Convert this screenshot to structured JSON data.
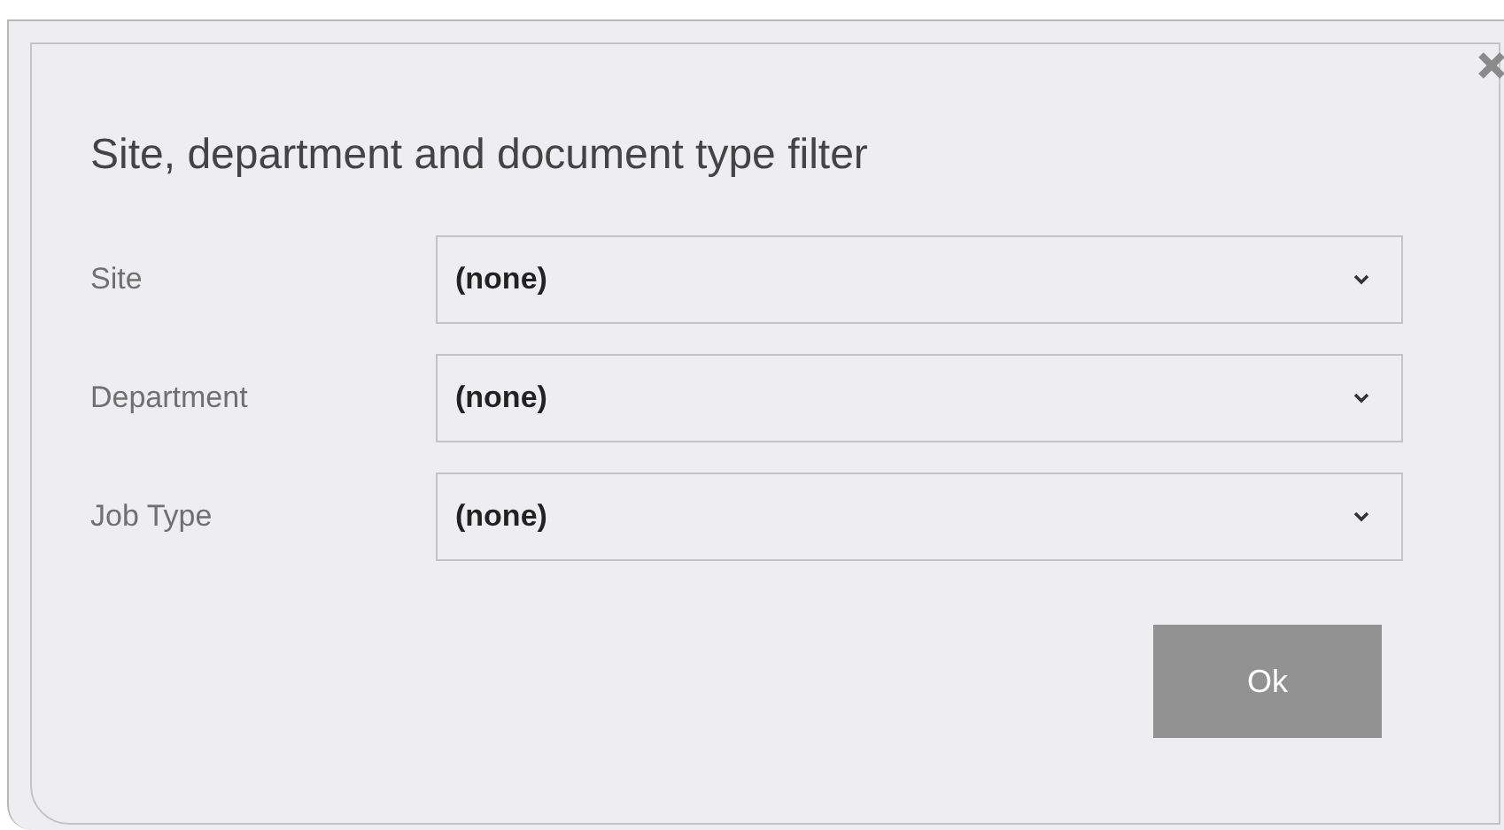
{
  "dialog": {
    "title": "Site, department and document type filter"
  },
  "filters": [
    {
      "label": "Site",
      "value": "(none)"
    },
    {
      "label": "Department",
      "value": "(none)"
    },
    {
      "label": "Job Type",
      "value": "(none)"
    }
  ],
  "ok_button": {
    "label": "Ok",
    "disabled": true
  }
}
